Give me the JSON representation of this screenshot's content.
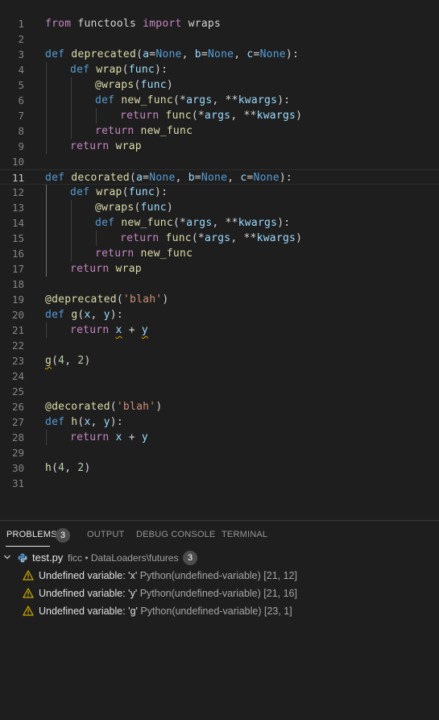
{
  "editor": {
    "current_line": 11,
    "lines": [
      {
        "n": "1",
        "indent": 0,
        "tokens": [
          [
            "kw2",
            "from"
          ],
          [
            "p",
            " functools "
          ],
          [
            "kw2",
            "import"
          ],
          [
            "p",
            " wraps"
          ]
        ]
      },
      {
        "n": "2",
        "indent": 0,
        "tokens": []
      },
      {
        "n": "3",
        "indent": 0,
        "tokens": [
          [
            "kw",
            "def"
          ],
          [
            "p",
            " "
          ],
          [
            "fn",
            "deprecated"
          ],
          [
            "p",
            "("
          ],
          [
            "par",
            "a"
          ],
          [
            "p",
            "="
          ],
          [
            "kw",
            "None"
          ],
          [
            "p",
            ", "
          ],
          [
            "par",
            "b"
          ],
          [
            "p",
            "="
          ],
          [
            "kw",
            "None"
          ],
          [
            "p",
            ", "
          ],
          [
            "par",
            "c"
          ],
          [
            "p",
            "="
          ],
          [
            "kw",
            "None"
          ],
          [
            "p",
            "):"
          ]
        ]
      },
      {
        "n": "4",
        "indent": 1,
        "tokens": [
          [
            "kw",
            "def"
          ],
          [
            "p",
            " "
          ],
          [
            "fn",
            "wrap"
          ],
          [
            "p",
            "("
          ],
          [
            "par",
            "func"
          ],
          [
            "p",
            "):"
          ]
        ]
      },
      {
        "n": "5",
        "indent": 2,
        "tokens": [
          [
            "fn",
            "@wraps"
          ],
          [
            "p",
            "("
          ],
          [
            "par",
            "func"
          ],
          [
            "p",
            ")"
          ]
        ]
      },
      {
        "n": "6",
        "indent": 2,
        "tokens": [
          [
            "kw",
            "def"
          ],
          [
            "p",
            " "
          ],
          [
            "fn",
            "new_func"
          ],
          [
            "p",
            "(*"
          ],
          [
            "par",
            "args"
          ],
          [
            "p",
            ", **"
          ],
          [
            "par",
            "kwargs"
          ],
          [
            "p",
            "):"
          ]
        ]
      },
      {
        "n": "7",
        "indent": 3,
        "tokens": [
          [
            "kw2",
            "return"
          ],
          [
            "p",
            " "
          ],
          [
            "fn",
            "func"
          ],
          [
            "p",
            "(*"
          ],
          [
            "par",
            "args"
          ],
          [
            "p",
            ", **"
          ],
          [
            "par",
            "kwargs"
          ],
          [
            "p",
            ")"
          ]
        ]
      },
      {
        "n": "8",
        "indent": 2,
        "tokens": [
          [
            "kw2",
            "return"
          ],
          [
            "p",
            " "
          ],
          [
            "fn",
            "new_func"
          ]
        ]
      },
      {
        "n": "9",
        "indent": 1,
        "tokens": [
          [
            "kw2",
            "return"
          ],
          [
            "p",
            " "
          ],
          [
            "fn",
            "wrap"
          ]
        ]
      },
      {
        "n": "10",
        "indent": 0,
        "tokens": []
      },
      {
        "n": "11",
        "indent": 0,
        "tokens": [
          [
            "kw",
            "def"
          ],
          [
            "p",
            " "
          ],
          [
            "fn",
            "decorated"
          ],
          [
            "p",
            "("
          ],
          [
            "par",
            "a"
          ],
          [
            "p",
            "="
          ],
          [
            "kw",
            "None"
          ],
          [
            "p",
            ", "
          ],
          [
            "par",
            "b"
          ],
          [
            "p",
            "="
          ],
          [
            "kw",
            "None"
          ],
          [
            "p",
            ", "
          ],
          [
            "par",
            "c"
          ],
          [
            "p",
            "="
          ],
          [
            "kw",
            "None"
          ],
          [
            "p",
            "):"
          ]
        ]
      },
      {
        "n": "12",
        "indent": 1,
        "tokens": [
          [
            "kw",
            "def"
          ],
          [
            "p",
            " "
          ],
          [
            "fn",
            "wrap"
          ],
          [
            "p",
            "("
          ],
          [
            "par",
            "func"
          ],
          [
            "p",
            "):"
          ]
        ]
      },
      {
        "n": "13",
        "indent": 2,
        "tokens": [
          [
            "fn",
            "@wraps"
          ],
          [
            "p",
            "("
          ],
          [
            "par",
            "func"
          ],
          [
            "p",
            ")"
          ]
        ]
      },
      {
        "n": "14",
        "indent": 2,
        "tokens": [
          [
            "kw",
            "def"
          ],
          [
            "p",
            " "
          ],
          [
            "fn",
            "new_func"
          ],
          [
            "p",
            "(*"
          ],
          [
            "par",
            "args"
          ],
          [
            "p",
            ", **"
          ],
          [
            "par",
            "kwargs"
          ],
          [
            "p",
            "):"
          ]
        ]
      },
      {
        "n": "15",
        "indent": 3,
        "tokens": [
          [
            "kw2",
            "return"
          ],
          [
            "p",
            " "
          ],
          [
            "fn",
            "func"
          ],
          [
            "p",
            "(*"
          ],
          [
            "par",
            "args"
          ],
          [
            "p",
            ", **"
          ],
          [
            "par",
            "kwargs"
          ],
          [
            "p",
            ")"
          ]
        ]
      },
      {
        "n": "16",
        "indent": 2,
        "tokens": [
          [
            "kw2",
            "return"
          ],
          [
            "p",
            " "
          ],
          [
            "fn",
            "new_func"
          ]
        ]
      },
      {
        "n": "17",
        "indent": 1,
        "tokens": [
          [
            "kw2",
            "return"
          ],
          [
            "p",
            " "
          ],
          [
            "fn",
            "wrap"
          ]
        ]
      },
      {
        "n": "18",
        "indent": 0,
        "tokens": []
      },
      {
        "n": "19",
        "indent": 0,
        "tokens": [
          [
            "fn",
            "@deprecated"
          ],
          [
            "p",
            "("
          ],
          [
            "str",
            "'blah'"
          ],
          [
            "p",
            ")"
          ]
        ]
      },
      {
        "n": "20",
        "indent": 0,
        "tokens": [
          [
            "kw",
            "def"
          ],
          [
            "p",
            " "
          ],
          [
            "fn",
            "g"
          ],
          [
            "p",
            "("
          ],
          [
            "par",
            "x"
          ],
          [
            "p",
            ", "
          ],
          [
            "par",
            "y"
          ],
          [
            "p",
            "):"
          ]
        ]
      },
      {
        "n": "21",
        "indent": 1,
        "tokens": [
          [
            "kw2",
            "return"
          ],
          [
            "p",
            " "
          ],
          [
            "sq",
            "x"
          ],
          [
            "p",
            " + "
          ],
          [
            "sq",
            "y"
          ]
        ]
      },
      {
        "n": "22",
        "indent": 0,
        "tokens": []
      },
      {
        "n": "23",
        "indent": 0,
        "tokens": [
          [
            "sqf",
            "g"
          ],
          [
            "p",
            "("
          ],
          [
            "num",
            "4"
          ],
          [
            "p",
            ", "
          ],
          [
            "num",
            "2"
          ],
          [
            "p",
            ")"
          ]
        ]
      },
      {
        "n": "24",
        "indent": 0,
        "tokens": []
      },
      {
        "n": "25",
        "indent": 0,
        "tokens": []
      },
      {
        "n": "26",
        "indent": 0,
        "tokens": [
          [
            "fn",
            "@decorated"
          ],
          [
            "p",
            "("
          ],
          [
            "str",
            "'blah'"
          ],
          [
            "p",
            ")"
          ]
        ]
      },
      {
        "n": "27",
        "indent": 0,
        "tokens": [
          [
            "kw",
            "def"
          ],
          [
            "p",
            " "
          ],
          [
            "fn",
            "h"
          ],
          [
            "p",
            "("
          ],
          [
            "par",
            "x"
          ],
          [
            "p",
            ", "
          ],
          [
            "par",
            "y"
          ],
          [
            "p",
            "):"
          ]
        ]
      },
      {
        "n": "28",
        "indent": 1,
        "tokens": [
          [
            "kw2",
            "return"
          ],
          [
            "p",
            " "
          ],
          [
            "par",
            "x"
          ],
          [
            "p",
            " + "
          ],
          [
            "par",
            "y"
          ]
        ]
      },
      {
        "n": "29",
        "indent": 0,
        "tokens": []
      },
      {
        "n": "30",
        "indent": 0,
        "tokens": [
          [
            "fn",
            "h"
          ],
          [
            "p",
            "("
          ],
          [
            "num",
            "4"
          ],
          [
            "p",
            ", "
          ],
          [
            "num",
            "2"
          ],
          [
            "p",
            ")"
          ]
        ]
      },
      {
        "n": "31",
        "indent": 0,
        "tokens": []
      }
    ]
  },
  "panel": {
    "tabs": {
      "problems": "PROBLEMS",
      "problems_count": "3",
      "output": "OUTPUT",
      "debug_console": "DEBUG CONSOLE",
      "terminal": "TERMINAL"
    },
    "file": {
      "name": "test.py",
      "path": "ficc • DataLoaders\\futures",
      "count": "3"
    },
    "problems": [
      {
        "message": "Undefined variable: 'x'",
        "source": "Python(undefined-variable)",
        "location": "[21, 12]"
      },
      {
        "message": "Undefined variable: 'y'",
        "source": "Python(undefined-variable)",
        "location": "[21, 16]"
      },
      {
        "message": "Undefined variable: 'g'",
        "source": "Python(undefined-variable)",
        "location": "[23, 1]"
      }
    ]
  },
  "colors": {
    "background": "#1e1e1e",
    "keyword": "#569cd6",
    "control": "#c586c0",
    "function": "#dcdcaa",
    "parameter": "#9cdcfe",
    "string": "#ce9178",
    "number": "#b5cea8",
    "warning": "#cca700"
  },
  "icons": [
    "chevron-down-icon",
    "python-file-icon",
    "warning-icon"
  ]
}
